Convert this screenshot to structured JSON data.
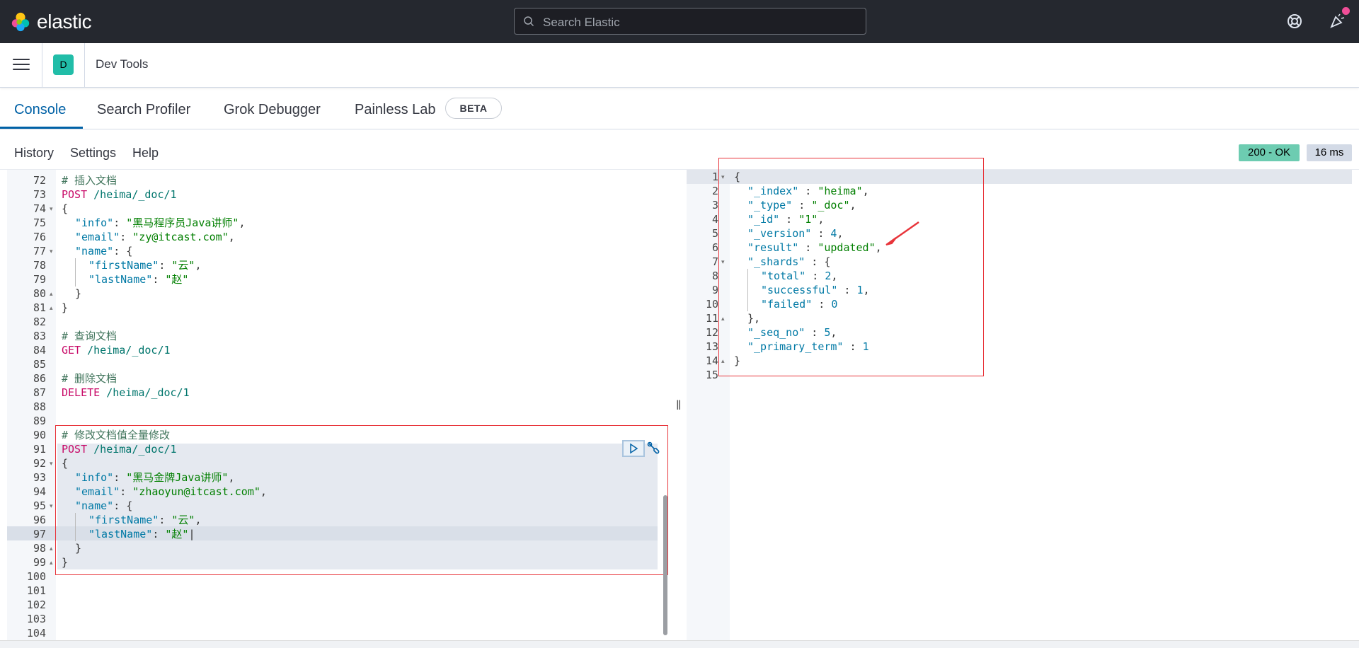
{
  "header": {
    "brand": "elastic",
    "search_placeholder": "Search Elastic",
    "icons": [
      "help-icon",
      "newsfeed-icon"
    ]
  },
  "subheader": {
    "space_initial": "D",
    "app_title": "Dev Tools"
  },
  "tabs": [
    {
      "label": "Console",
      "active": true
    },
    {
      "label": "Search Profiler",
      "active": false
    },
    {
      "label": "Grok Debugger",
      "active": false
    },
    {
      "label": "Painless Lab",
      "active": false
    }
  ],
  "beta_badge": "BETA",
  "console_menu": {
    "history": "History",
    "settings": "Settings",
    "help": "Help"
  },
  "response_status": {
    "code": "200 - OK",
    "time": "16 ms"
  },
  "request_editor": {
    "line_numbers": [
      "72",
      "73",
      "74",
      "75",
      "76",
      "77",
      "78",
      "79",
      "80",
      "81",
      "82",
      "83",
      "84",
      "85",
      "86",
      "87",
      "88",
      "89",
      "90",
      "91",
      "92",
      "93",
      "94",
      "95",
      "96",
      "97",
      "98",
      "99",
      "100",
      "101",
      "102",
      "103",
      "104"
    ],
    "lines": {
      "l72": "# 插入文档",
      "l73_method": "POST",
      "l73_url": " /heima/_doc/1",
      "l74": "{",
      "l75_key": "\"info\"",
      "l75_val": "\"黑马程序员Java讲师\"",
      "l76_key": "\"email\"",
      "l76_val": "\"zy@itcast.com\"",
      "l77_key": "\"name\"",
      "l78_key": "\"firstName\"",
      "l78_val": "\"云\"",
      "l79_key": "\"lastName\"",
      "l79_val": "\"赵\"",
      "l80": "}",
      "l81": "}",
      "l83": "# 查询文档",
      "l84_method": "GET",
      "l84_url": " /heima/_doc/1",
      "l86": "# 删除文档",
      "l87_method": "DELETE",
      "l87_url": " /heima/_doc/1",
      "l90": "# 修改文档值全量修改",
      "l91_method": "POST",
      "l91_url": " /heima/_doc/1",
      "l92": "{",
      "l93_key": "\"info\"",
      "l93_val": "\"黑马金牌Java讲师\"",
      "l94_key": "\"email\"",
      "l94_val": "\"zhaoyun@itcast.com\"",
      "l95_key": "\"name\"",
      "l96_key": "\"firstName\"",
      "l96_val": "\"云\"",
      "l97_key": "\"lastName\"",
      "l97_val": "\"赵\"",
      "l98": "}",
      "l99": "}"
    }
  },
  "response_editor": {
    "line_numbers": [
      "1",
      "2",
      "3",
      "4",
      "5",
      "6",
      "7",
      "8",
      "9",
      "10",
      "11",
      "12",
      "13",
      "14",
      "15"
    ],
    "lines": {
      "r1": "{",
      "r2_key": "\"_index\"",
      "r2_val": "\"heima\"",
      "r3_key": "\"_type\"",
      "r3_val": "\"_doc\"",
      "r4_key": "\"_id\"",
      "r4_val": "\"1\"",
      "r5_key": "\"_version\"",
      "r5_val": "4",
      "r6_key": "\"result\"",
      "r6_val": "\"updated\"",
      "r7_key": "\"_shards\"",
      "r8_key": "\"total\"",
      "r8_val": "2",
      "r9_key": "\"successful\"",
      "r9_val": "1",
      "r10_key": "\"failed\"",
      "r10_val": "0",
      "r11": "},",
      "r12_key": "\"_seq_no\"",
      "r12_val": "5",
      "r13_key": "\"_primary_term\"",
      "r13_val": "1",
      "r14": "}"
    }
  },
  "colors": {
    "header_bg": "#25282f",
    "accent": "#0061a6",
    "status_ok": "#6dccb1",
    "annotation_red": "#e8343a"
  }
}
